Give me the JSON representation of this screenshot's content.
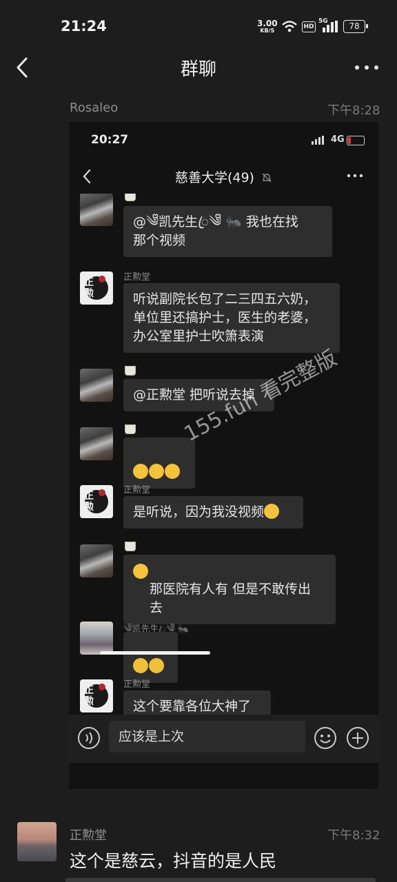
{
  "status_bar": {
    "time": "21:24",
    "net_speed_value": "3.00",
    "net_speed_unit": "KB/S",
    "hd": "HD",
    "signal": "5G",
    "battery": "78"
  },
  "header": {
    "title": "群聊"
  },
  "message1": {
    "sender": "Rosaleo",
    "time": "下午8:28"
  },
  "screenshot": {
    "status_time": "20:27",
    "network": "4G",
    "title": "慈善大学(49)",
    "messages": [
      {
        "nick": "",
        "text": "@༄ᩚ凯先生ꦿ༄ᩚ 🐜 我也在找\n那个视频"
      },
      {
        "nick": "正勲堂",
        "text": "听说副院长包了二三四五六奶，\n单位里还搞护士，医生的老婆，\n办公室里护士吹箫表演"
      },
      {
        "nick": "",
        "text": "@正勲堂 把听说去掉"
      },
      {
        "nick": "",
        "text": ""
      },
      {
        "nick": "正勲堂",
        "text": "是听说，因为我没视频"
      },
      {
        "nick": "",
        "text": "那医院有人有 但是不敢传出\n去"
      },
      {
        "nick": "༄ᩚ凯先生ꦿ༄ᩚ 🐜",
        "text": ""
      },
      {
        "nick": "正勲堂",
        "text": "这个要靠各位大神了"
      }
    ],
    "input_text": "应该是上次",
    "watermark": "155.fun 看完整版",
    "seal_char_1": "正",
    "seal_char_2": "勲"
  },
  "message2": {
    "sender": "正勲堂",
    "time": "下午8:32",
    "text": "这个是慈云，抖音的是人民"
  }
}
